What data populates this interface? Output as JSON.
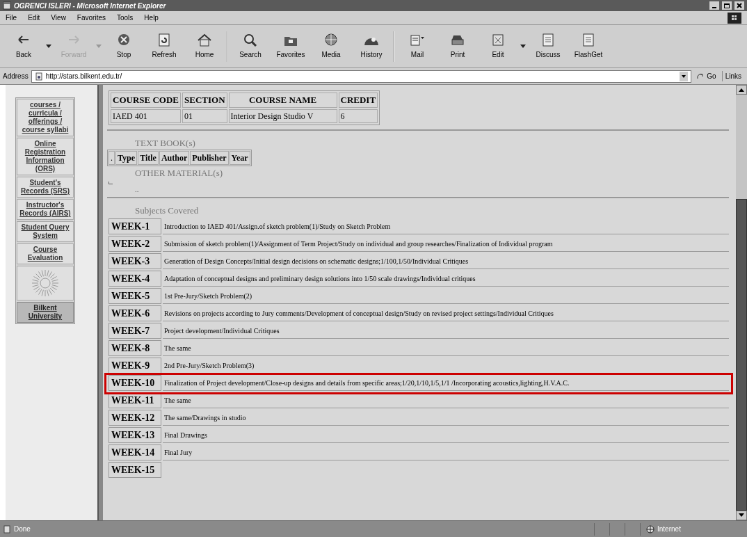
{
  "window": {
    "title": "OGRENCI ISLERI - Microsoft Internet Explorer"
  },
  "menu": [
    "File",
    "Edit",
    "View",
    "Favorites",
    "Tools",
    "Help"
  ],
  "toolbar": [
    {
      "label": "Back",
      "disabled": false,
      "dropdown": true
    },
    {
      "label": "Forward",
      "disabled": true,
      "dropdown": true
    },
    {
      "label": "Stop",
      "disabled": false,
      "dropdown": false
    },
    {
      "label": "Refresh",
      "disabled": false,
      "dropdown": false
    },
    {
      "label": "Home",
      "disabled": false,
      "dropdown": false
    },
    {
      "label": "Search",
      "disabled": false,
      "dropdown": false
    },
    {
      "label": "Favorites",
      "disabled": false,
      "dropdown": false
    },
    {
      "label": "Media",
      "disabled": false,
      "dropdown": false
    },
    {
      "label": "History",
      "disabled": false,
      "dropdown": false
    },
    {
      "label": "Mail",
      "disabled": false,
      "dropdown": false
    },
    {
      "label": "Print",
      "disabled": false,
      "dropdown": false
    },
    {
      "label": "Edit",
      "disabled": false,
      "dropdown": true
    },
    {
      "label": "Discuss",
      "disabled": false,
      "dropdown": false
    },
    {
      "label": "FlashGet",
      "disabled": false,
      "dropdown": false
    }
  ],
  "address": {
    "label": "Address",
    "value": "http://stars.bilkent.edu.tr/",
    "go": "Go",
    "links": "Links"
  },
  "sidebar": {
    "items": [
      "courses / curricula / offerings / course syllabi",
      "Online Registration Information (ORS)",
      "Student's Records (SRS)",
      "Instructor's Records (AIRS)",
      "Student Query System",
      "Course Evaluation"
    ],
    "footer": "Bilkent University"
  },
  "course_table": {
    "columns": [
      "COURSE CODE",
      "SECTION",
      "COURSE NAME",
      "CREDIT"
    ],
    "row": [
      "IAED 401",
      "01",
      "Interior Design Studio V",
      "6"
    ]
  },
  "textbook": {
    "heading": "TEXT BOOK(s)",
    "columns": [
      ".",
      "Type",
      "Title",
      "Author",
      "Publisher",
      "Year"
    ]
  },
  "other_material": {
    "heading": "OTHER MATERIAL(s)",
    "text": ".."
  },
  "subjects": {
    "heading": "Subjects Covered",
    "rows": [
      {
        "week": "WEEK-1",
        "text": "Introduction to IAED 401/Assign.of sketch problem(1)/Study on Sketch Problem",
        "highlighted": false
      },
      {
        "week": "WEEK-2",
        "text": "Submission of sketch problem(1)/Assignment of Term Project/Study on individual and group researches/Finalization of Individual program",
        "highlighted": false
      },
      {
        "week": "WEEK-3",
        "text": "Generation of Design Concepts/Initial design decisions on schematic designs;1/100,1/50/Individual Critiques",
        "highlighted": false
      },
      {
        "week": "WEEK-4",
        "text": "Adaptation of conceptual designs and preliminary design solutions into 1/50 scale drawings/Individual critiques",
        "highlighted": false
      },
      {
        "week": "WEEK-5",
        "text": "1st Pre-Jury/Sketch Problem(2)",
        "highlighted": false
      },
      {
        "week": "WEEK-6",
        "text": "Revisions on projects according to Jury comments/Development of conceptual design/Study on revised project settings/Individual Critiques",
        "highlighted": false
      },
      {
        "week": "WEEK-7",
        "text": "Project development/Individual Critiques",
        "highlighted": false
      },
      {
        "week": "WEEK-8",
        "text": "The same",
        "highlighted": false
      },
      {
        "week": "WEEK-9",
        "text": "2nd Pre-Jury/Sketch Problem(3)",
        "highlighted": false
      },
      {
        "week": "WEEK-10",
        "text": "Finalization of Project development/Close-up designs and details from specific areas;1/20,1/10,1/5,1/1 /Incorporating acoustics,lighting,H.V.A.C.",
        "highlighted": true
      },
      {
        "week": "WEEK-11",
        "text": "The same",
        "highlighted": false
      },
      {
        "week": "WEEK-12",
        "text": "The same/Drawings in studio",
        "highlighted": false
      },
      {
        "week": "WEEK-13",
        "text": "Final Drawings",
        "highlighted": false
      },
      {
        "week": "WEEK-14",
        "text": "Final Jury",
        "highlighted": false
      },
      {
        "week": "WEEK-15",
        "highlighted": false
      }
    ]
  },
  "status_bar": {
    "text": "Done",
    "zone": "Internet"
  }
}
